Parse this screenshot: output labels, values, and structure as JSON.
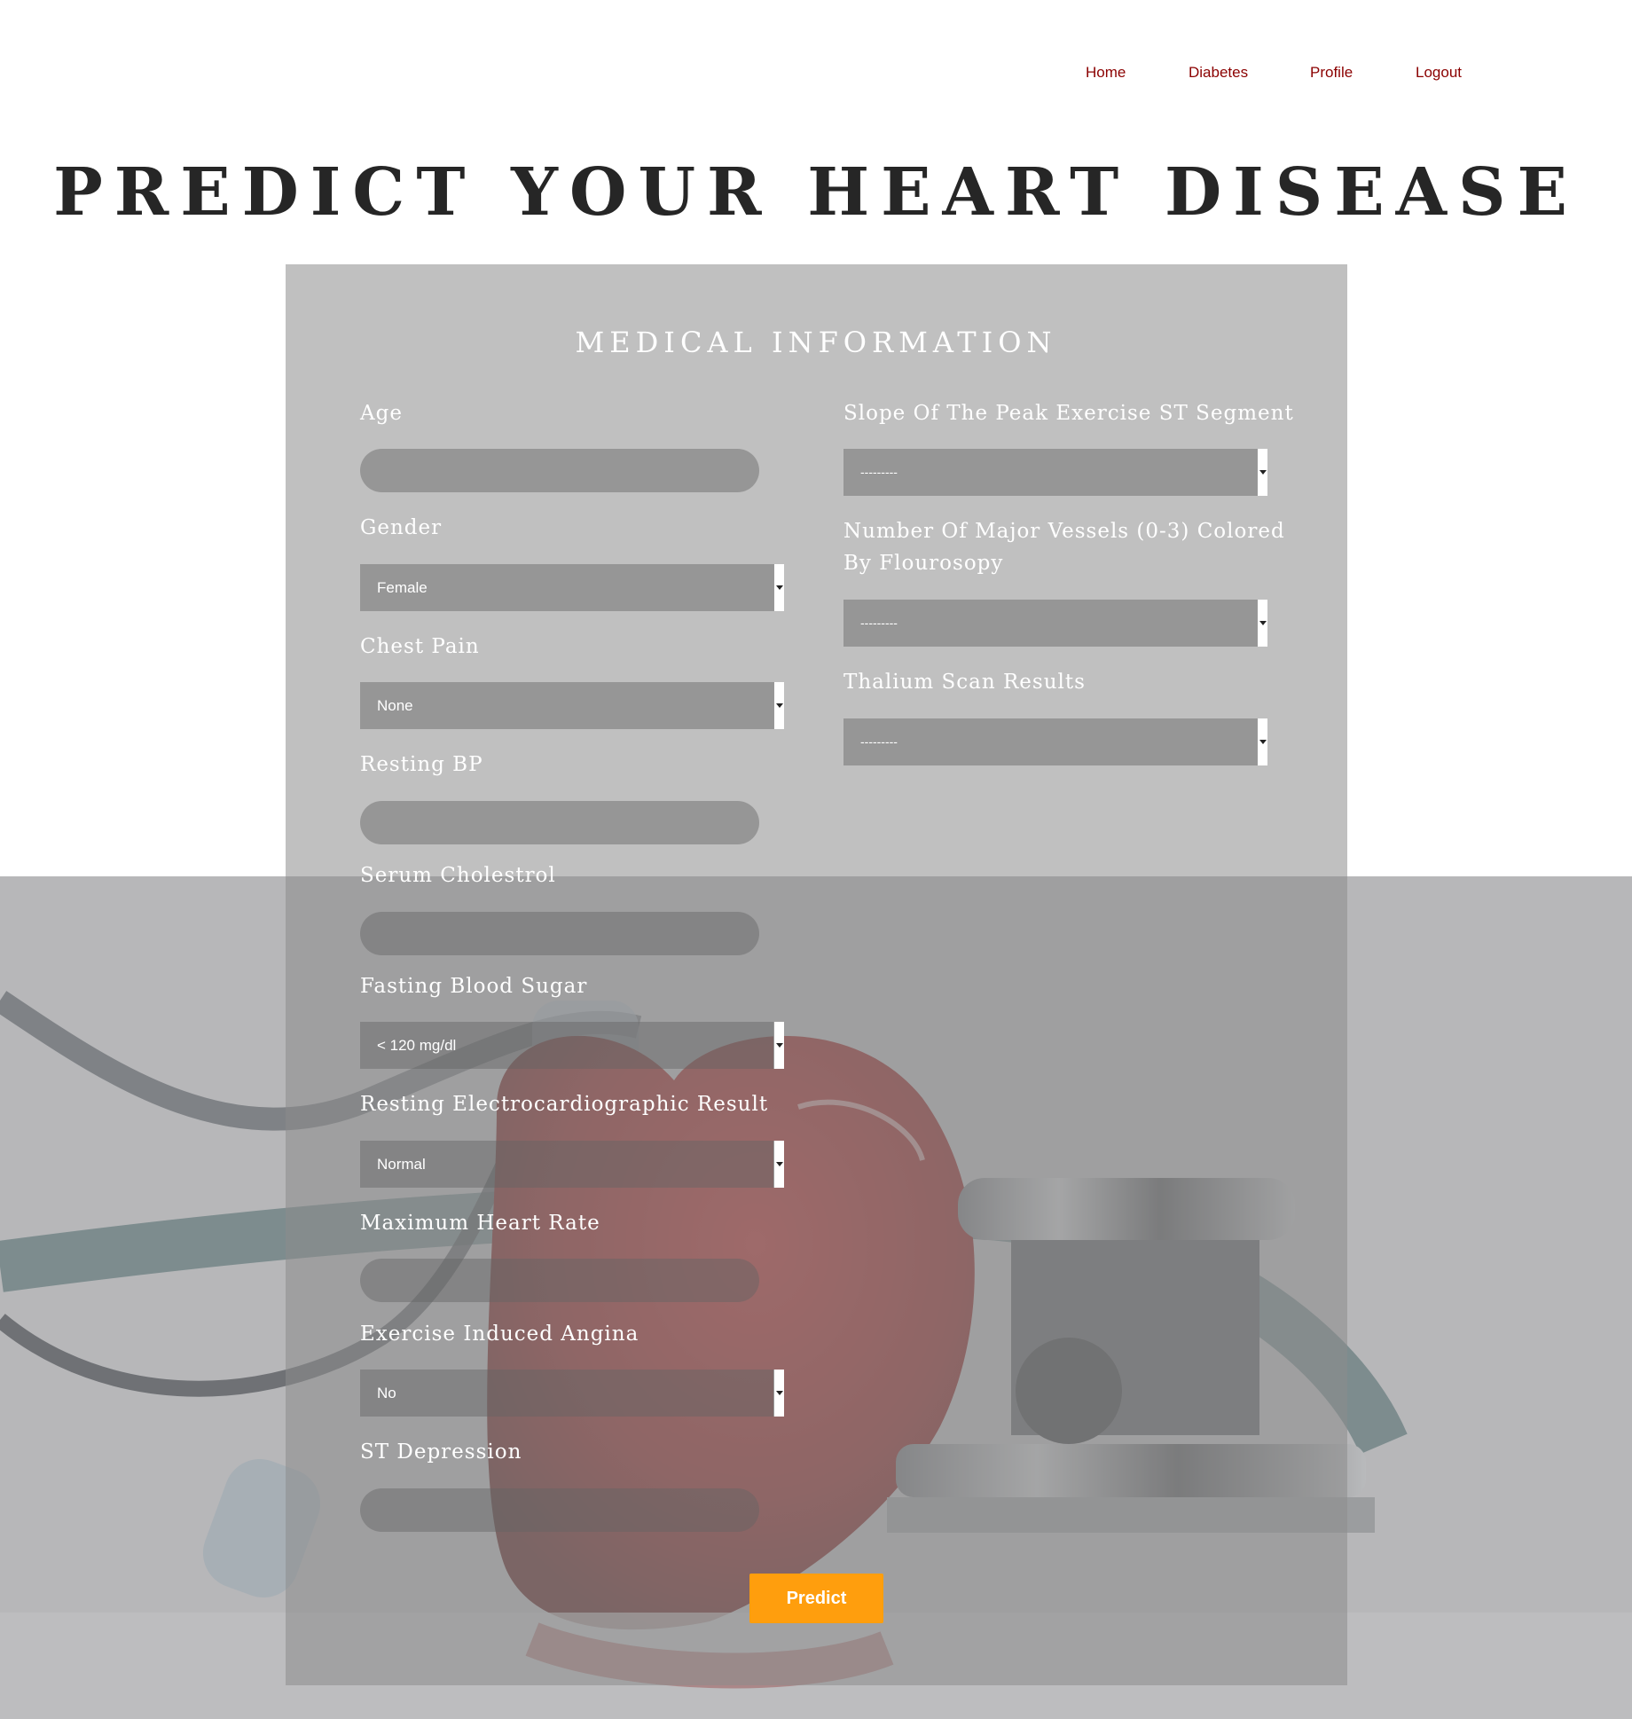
{
  "nav": {
    "items": [
      {
        "label": "Home"
      },
      {
        "label": "Diabetes"
      },
      {
        "label": "Profile"
      },
      {
        "label": "Logout"
      }
    ]
  },
  "page_title": "PREDICT YOUR HEART DISEASE",
  "form": {
    "title": "MEDICAL INFORMATION",
    "left_fields": [
      {
        "label": "Age",
        "type": "text",
        "value": ""
      },
      {
        "label": "Gender",
        "type": "select",
        "value": "Female"
      },
      {
        "label": "Chest Pain",
        "type": "select",
        "value": "None"
      },
      {
        "label": "Resting BP",
        "type": "text",
        "value": ""
      },
      {
        "label": "Serum Cholestrol",
        "type": "text",
        "value": ""
      },
      {
        "label": "Fasting Blood Sugar",
        "type": "select",
        "value": "< 120 mg/dl"
      },
      {
        "label": "Resting Electrocardiographic Result",
        "type": "select",
        "value": "Normal"
      },
      {
        "label": "Maximum Heart Rate",
        "type": "text",
        "value": ""
      },
      {
        "label": "Exercise Induced Angina",
        "type": "select",
        "value": "No"
      },
      {
        "label": "ST Depression",
        "type": "text",
        "value": ""
      }
    ],
    "right_fields": [
      {
        "label": "Slope Of The Peak Exercise ST Segment",
        "type": "select",
        "value": "---------"
      },
      {
        "label_line1": "Number Of Major Vessels (0-3) Colored",
        "label_line2": "By Flourosopy",
        "type": "select",
        "value": "---------"
      },
      {
        "label": "Thalium Scan Results",
        "type": "select",
        "value": "---------"
      }
    ],
    "submit_label": "Predict"
  },
  "colors": {
    "nav_link": "#8b0000",
    "button": "#ff9e0d",
    "title": "#262626"
  }
}
